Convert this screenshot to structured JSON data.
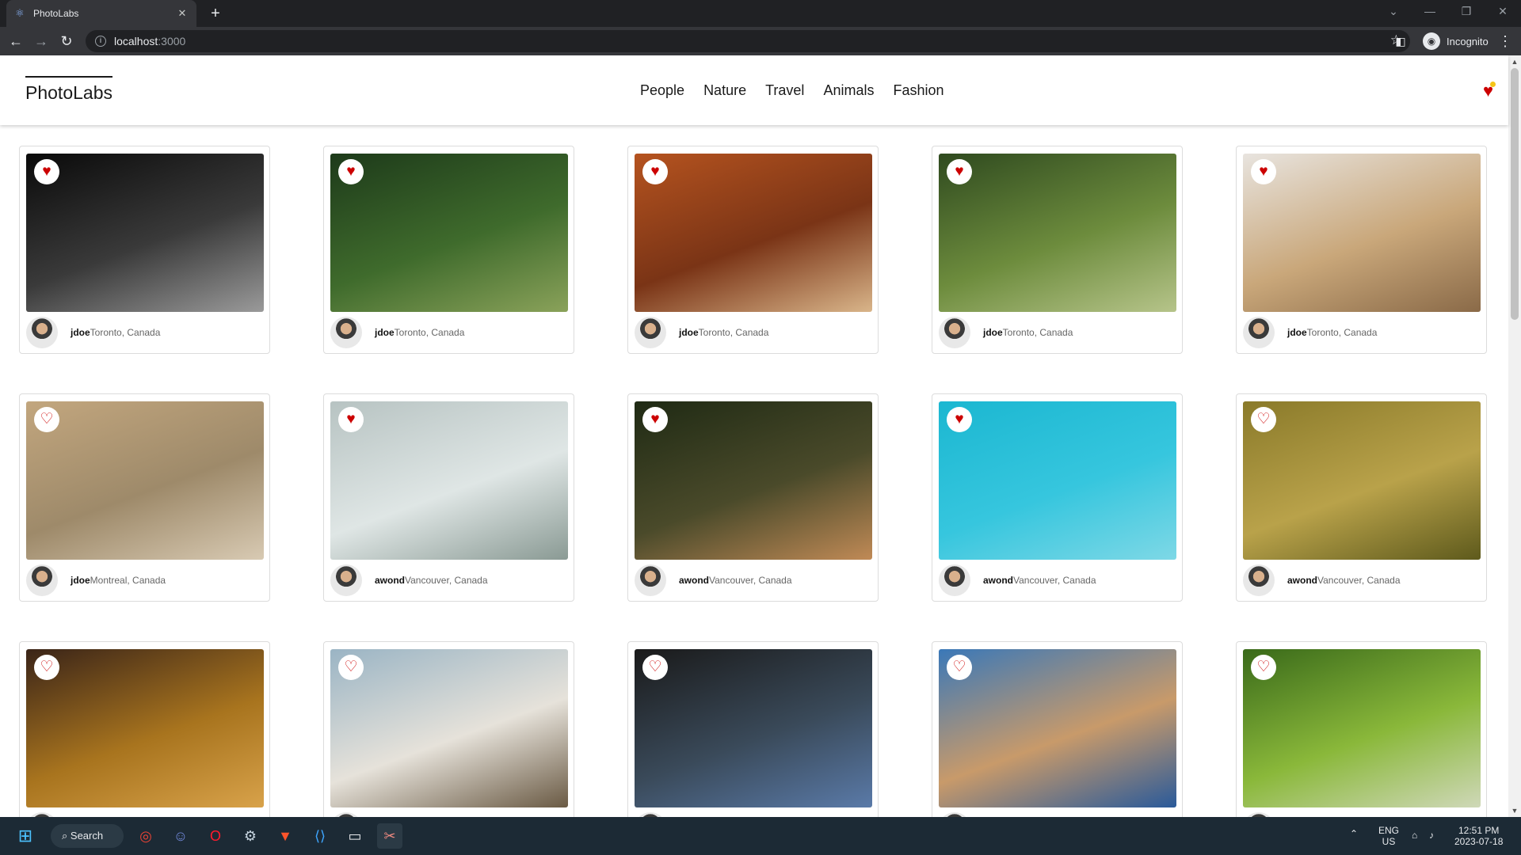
{
  "browser": {
    "tab_title": "PhotoLabs",
    "url_host": "localhost",
    "url_port": ":3000",
    "profile_label": "Incognito"
  },
  "app": {
    "logo": "PhotoLabs",
    "topics": [
      "People",
      "Nature",
      "Travel",
      "Animals",
      "Fashion"
    ],
    "favorites_indicator": "heart-with-notification"
  },
  "photos": [
    {
      "user": "jdoe",
      "location": "Toronto, Canada",
      "favourited": true,
      "theme": "man walking at night",
      "colors": [
        "#0a0a0a",
        "#3a3a3a",
        "#9a9a9a"
      ]
    },
    {
      "user": "jdoe",
      "location": "Toronto, Canada",
      "favourited": true,
      "theme": "jaguar in grass",
      "colors": [
        "#1d3a1a",
        "#3f6b2c",
        "#8aa25a"
      ]
    },
    {
      "user": "jdoe",
      "location": "Toronto, Canada",
      "favourited": true,
      "theme": "old city buildings",
      "colors": [
        "#b5531f",
        "#7a3416",
        "#d9b58a"
      ]
    },
    {
      "user": "jdoe",
      "location": "Toronto, Canada",
      "favourited": true,
      "theme": "horses on hillside",
      "colors": [
        "#2f4a1f",
        "#6d8c3d",
        "#b6c48a"
      ]
    },
    {
      "user": "jdoe",
      "location": "Toronto, Canada",
      "favourited": true,
      "theme": "smiling man with mug",
      "colors": [
        "#e8e4df",
        "#c9a77a",
        "#8a6a48"
      ]
    },
    {
      "user": "jdoe",
      "location": "Montreal, Canada",
      "favourited": false,
      "theme": "hand holding phone",
      "colors": [
        "#c2a67e",
        "#9e8a6a",
        "#d8cab3"
      ]
    },
    {
      "user": "awond",
      "location": "Vancouver, Canada",
      "favourited": true,
      "theme": "woman in white sweater",
      "colors": [
        "#b7c3c2",
        "#dfe6e5",
        "#8a9a94"
      ]
    },
    {
      "user": "awond",
      "location": "Vancouver, Canada",
      "favourited": true,
      "theme": "dog lying on grass",
      "colors": [
        "#1f2a14",
        "#4a4a2a",
        "#c08a56"
      ]
    },
    {
      "user": "awond",
      "location": "Vancouver, Canada",
      "favourited": true,
      "theme": "palm trees and sky",
      "colors": [
        "#1bb7d1",
        "#36c6de",
        "#7ed8e6"
      ]
    },
    {
      "user": "awond",
      "location": "Vancouver, Canada",
      "favourited": false,
      "theme": "bird in reeds",
      "colors": [
        "#8a7a2a",
        "#b9a24a",
        "#5e5a1c"
      ]
    },
    {
      "user": "",
      "location": "",
      "favourited": false,
      "theme": "woman with curly hair",
      "colors": [
        "#3a2418",
        "#a8741e",
        "#d8a24a"
      ]
    },
    {
      "user": "",
      "location": "",
      "favourited": false,
      "theme": "man in denim shirt",
      "colors": [
        "#9ab4c4",
        "#e6e2da",
        "#6a5a44"
      ]
    },
    {
      "user": "",
      "location": "",
      "favourited": false,
      "theme": "black dog close-up",
      "colors": [
        "#1a1a1a",
        "#3a4a5a",
        "#5a7aa8"
      ]
    },
    {
      "user": "",
      "location": "",
      "favourited": false,
      "theme": "coastal town harbour",
      "colors": [
        "#3a78b8",
        "#c89a6a",
        "#2a5a9a"
      ]
    },
    {
      "user": "",
      "location": "",
      "favourited": false,
      "theme": "rice terraces",
      "colors": [
        "#3a6a1a",
        "#8ab83a",
        "#cfd8b8"
      ]
    }
  ],
  "taskbar": {
    "search_label": "Search",
    "lang_top": "ENG",
    "lang_bottom": "US",
    "time": "12:51 PM",
    "date": "2023-07-18"
  }
}
